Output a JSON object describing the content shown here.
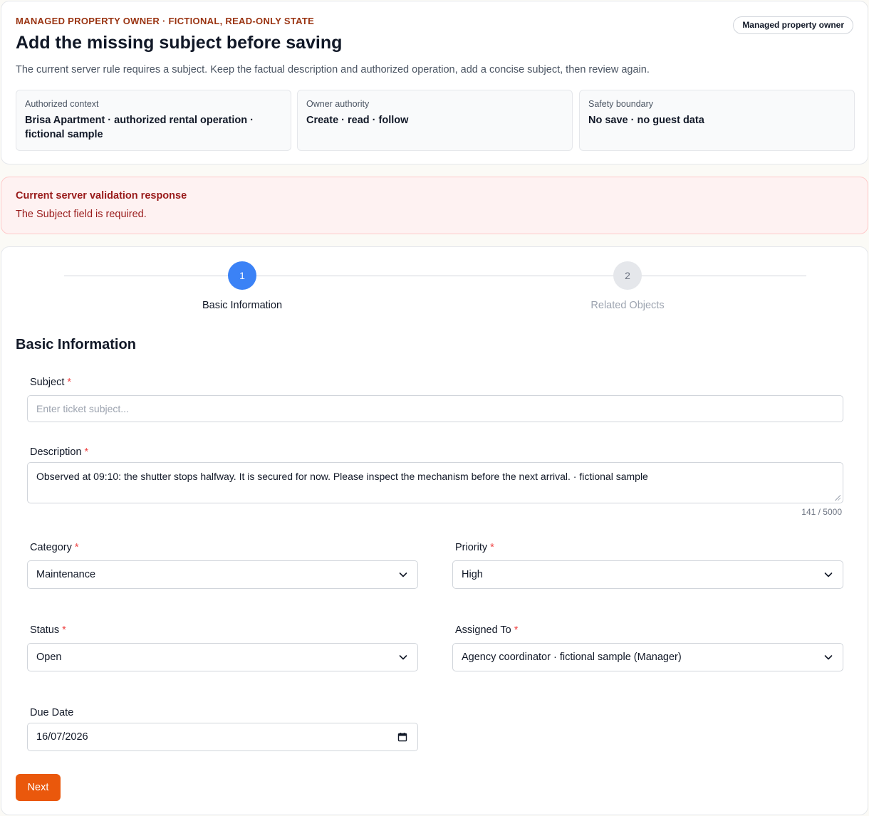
{
  "header": {
    "eyebrow": "MANAGED PROPERTY OWNER · FICTIONAL, READ-ONLY STATE",
    "role_badge": "Managed property owner",
    "title": "Add the missing subject before saving",
    "description": "The current server rule requires a subject. Keep the factual description and authorized operation, add a concise subject, then review again.",
    "info_boxes": [
      {
        "label": "Authorized context",
        "value_line1": "Brisa Apartment · authorized rental operation ·",
        "value_line2": "fictional sample"
      },
      {
        "label": "Owner authority",
        "value_line1": "Create · read · follow",
        "value_line2": ""
      },
      {
        "label": "Safety boundary",
        "value_line1": "No save · no guest data",
        "value_line2": ""
      }
    ]
  },
  "validation": {
    "title": "Current server validation response",
    "message": "The Subject field is required."
  },
  "stepper": {
    "steps": [
      {
        "number": "1",
        "label": "Basic Information",
        "active": true
      },
      {
        "number": "2",
        "label": "Related Objects",
        "active": false
      }
    ]
  },
  "form": {
    "section_title": "Basic Information",
    "required_mark": "*",
    "subject": {
      "label": "Subject",
      "value": "",
      "placeholder": "Enter ticket subject..."
    },
    "description": {
      "label": "Description",
      "value": "Observed at 09:10: the shutter stops halfway. It is secured for now. Please inspect the mechanism before the next arrival. · fictional sample",
      "char_count": "141 / 5000"
    },
    "category": {
      "label": "Category",
      "value": "Maintenance"
    },
    "priority": {
      "label": "Priority",
      "value": "High"
    },
    "status": {
      "label": "Status",
      "value": "Open"
    },
    "assigned_to": {
      "label": "Assigned To",
      "value": "Agency coordinator · fictional sample (Manager)"
    },
    "due_date": {
      "label": "Due Date",
      "value": "16/07/2026"
    },
    "next_label": "Next"
  },
  "colors": {
    "accent": "#ea580c",
    "step_active": "#3b82f6",
    "error_text": "#991b1b",
    "error_bg": "#fef2f2",
    "eyebrow": "#9a3412",
    "required": "#ef4444"
  },
  "icons": {
    "select_arrow": "chevron-down-icon",
    "date_picker": "calendar-icon"
  }
}
